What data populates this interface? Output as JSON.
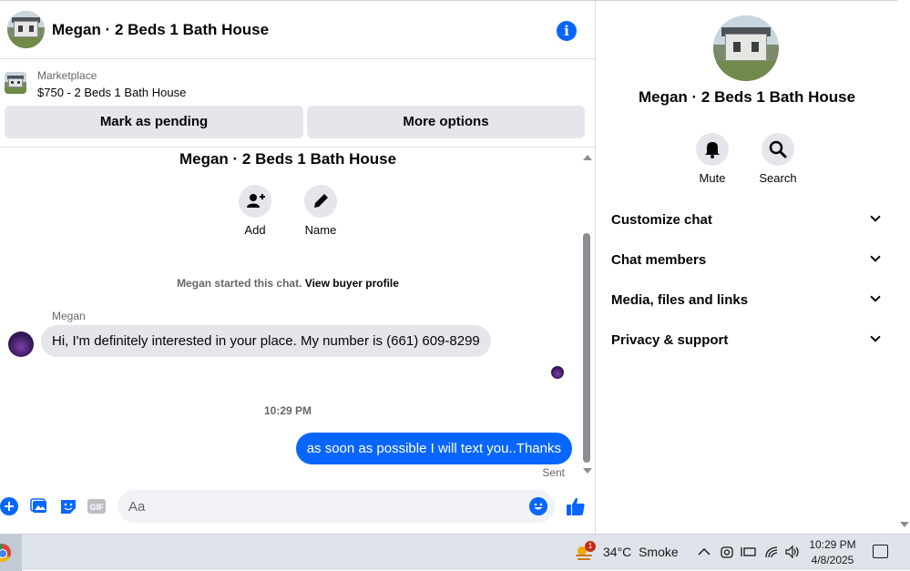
{
  "header": {
    "title": "Megan · 2 Beds 1 Bath House"
  },
  "listing": {
    "label": "Marketplace",
    "price_title": "$750 - 2 Beds 1 Bath House",
    "pending_button": "Mark as pending",
    "options_button": "More options"
  },
  "thread": {
    "title": "Megan · 2 Beds 1 Bath House",
    "add_label": "Add",
    "name_label": "Name",
    "started_text": "Megan started this chat.",
    "view_profile": "View buyer profile",
    "sender_name": "Megan",
    "incoming_message": "Hi, I'm definitely interested in your place. My number is (661) 609-8299",
    "timestamp": "10:29 PM",
    "outgoing_message": "as soon as possible I will text you..Thanks",
    "sent_status": "Sent"
  },
  "composer": {
    "placeholder": "Aa"
  },
  "details": {
    "title": "Megan · 2 Beds 1 Bath House",
    "mute_label": "Mute",
    "search_label": "Search",
    "sections": [
      "Customize chat",
      "Chat members",
      "Media, files and links",
      "Privacy & support"
    ]
  },
  "taskbar": {
    "weather_badge": "1",
    "temperature": "34°C",
    "weather_text": "Smoke",
    "time": "10:29 PM",
    "date": "4/8/2025"
  },
  "colors": {
    "accent": "#0866ff",
    "bubble_gray": "#e4e6eb"
  },
  "icons": [
    "info-icon",
    "add-person-icon",
    "pencil-icon",
    "bell-icon",
    "search-icon",
    "chevron-down-icon",
    "plus-icon",
    "photo-icon",
    "sticker-icon",
    "gif-icon",
    "emoji-icon",
    "like-icon"
  ]
}
